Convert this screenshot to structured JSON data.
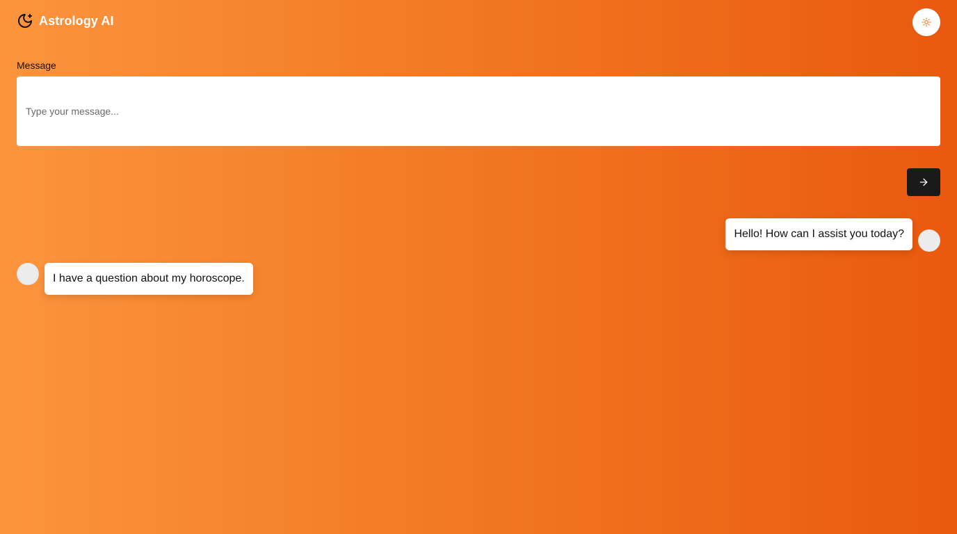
{
  "app": {
    "title": "Astrology AI",
    "logo_icon": "moon-star-icon",
    "theme_toggle_icon": "sun-icon"
  },
  "form": {
    "label": "Message",
    "placeholder": "Type your message...",
    "value": "",
    "send_icon": "arrow-right-icon"
  },
  "messages": [
    {
      "side": "right",
      "text": "Hello! How can I assist you today?"
    },
    {
      "side": "left",
      "text": "I have a question about my horoscope."
    }
  ],
  "colors": {
    "gradient_start": "#fc943e",
    "gradient_end": "#e9590f",
    "send_button": "#1a1a1a",
    "accent": "#f97316"
  }
}
